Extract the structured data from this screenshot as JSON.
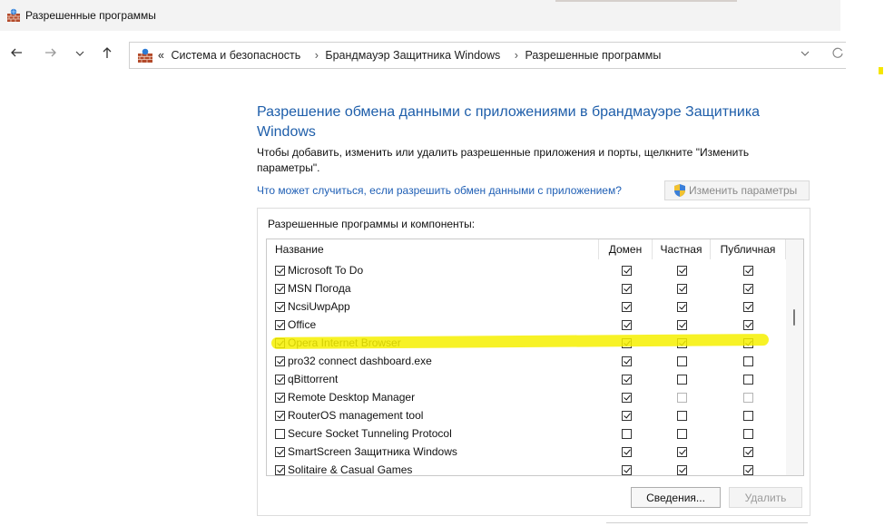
{
  "window": {
    "title": "Разрешенные программы"
  },
  "nav": {
    "back_icon": "arrow-left-icon",
    "forward_icon": "arrow-right-icon",
    "recent_icon": "chevron-down-icon",
    "up_icon": "arrow-up-icon",
    "overflow": "«",
    "breadcrumbs": [
      "Система и безопасность",
      "Брандмауэр Защитника Windows",
      "Разрешенные программы"
    ],
    "separator": "›"
  },
  "main": {
    "heading": "Разрешение обмена данными с приложениями в брандмауэре Защитника Windows",
    "description": "Чтобы добавить, изменить или удалить разрешенные приложения и порты, щелкните \"Изменить параметры\".",
    "help_link": "Что может случиться, если разрешить обмен данными с приложением?",
    "change_button": "Изменить параметры"
  },
  "group": {
    "title": "Разрешенные программы и компоненты:",
    "columns": {
      "name": "Название",
      "domain": "Домен",
      "private": "Частная",
      "public": "Публичная"
    },
    "rows": [
      {
        "name": "Microsoft To Do",
        "enabled": true,
        "domain": true,
        "private": true,
        "public": true
      },
      {
        "name": "MSN Погода",
        "enabled": true,
        "domain": true,
        "private": true,
        "public": true
      },
      {
        "name": "NcsiUwpApp",
        "enabled": true,
        "domain": true,
        "private": true,
        "public": true
      },
      {
        "name": "Office",
        "enabled": true,
        "domain": true,
        "private": true,
        "public": true
      },
      {
        "name": "Opera Internet Browser",
        "enabled": true,
        "domain": true,
        "private": true,
        "public": true,
        "highlighted": true
      },
      {
        "name": "pro32 connect dashboard.exe",
        "enabled": true,
        "domain": true,
        "private": false,
        "public": false
      },
      {
        "name": "qBittorrent",
        "enabled": true,
        "domain": true,
        "private": false,
        "public": false
      },
      {
        "name": "Remote Desktop Manager",
        "enabled": true,
        "domain": true,
        "private": false,
        "public": false,
        "disabled_private_public": true
      },
      {
        "name": "RouterOS management tool",
        "enabled": true,
        "domain": true,
        "private": false,
        "public": false
      },
      {
        "name": "Secure Socket Tunneling Protocol",
        "enabled": false,
        "domain": false,
        "private": false,
        "public": false
      },
      {
        "name": "SmartScreen Защитника Windows",
        "enabled": true,
        "domain": true,
        "private": true,
        "public": true
      },
      {
        "name": "Solitaire & Casual Games",
        "enabled": true,
        "domain": true,
        "private": true,
        "public": true
      }
    ],
    "details_button": "Сведения...",
    "delete_button": "Удалить"
  },
  "colors": {
    "heading": "#1e5eaa",
    "link": "#1f5fb5",
    "highlight": "#f6f000"
  }
}
